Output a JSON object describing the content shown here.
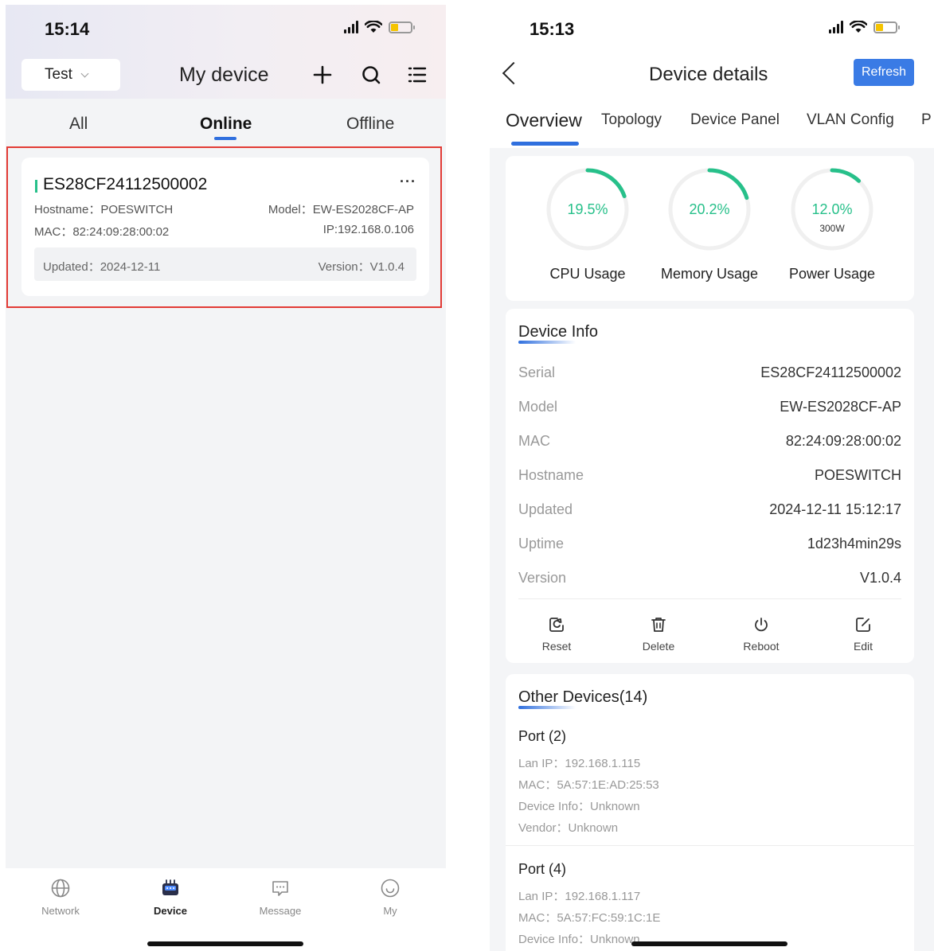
{
  "left": {
    "status": {
      "time": "15:14"
    },
    "header": {
      "org_select": "Test",
      "title": "My device"
    },
    "filter_tabs": [
      {
        "label": "All"
      },
      {
        "label": "Online",
        "active": true
      },
      {
        "label": "Offline"
      }
    ],
    "device_card": {
      "serial": "ES28CF24112500002",
      "more": "···",
      "hostname": "Hostname：POESWITCH",
      "model": "Model：EW-ES2028CF-AP",
      "mac": "MAC：82:24:09:28:00:02",
      "ip": "IP:192.168.0.106",
      "updated": "Updated：2024-12-11",
      "version": "Version：V1.0.4"
    },
    "tabbar": [
      {
        "label": "Network",
        "icon": "globe-icon"
      },
      {
        "label": "Device",
        "icon": "switch-icon",
        "active": true
      },
      {
        "label": "Message",
        "icon": "chat-icon"
      },
      {
        "label": "My",
        "icon": "smile-icon"
      }
    ]
  },
  "right": {
    "status": {
      "time": "15:13"
    },
    "header": {
      "title": "Device details",
      "refresh": "Refresh"
    },
    "tabs": [
      {
        "label": "Overview",
        "active": true
      },
      {
        "label": "Topology"
      },
      {
        "label": "Device Panel"
      },
      {
        "label": "VLAN Config"
      },
      {
        "label": "P"
      }
    ],
    "usage": [
      {
        "label": "CPU Usage",
        "value": "19.5%",
        "percent": 19.5,
        "sub": ""
      },
      {
        "label": "Memory Usage",
        "value": "20.2%",
        "percent": 20.2,
        "sub": ""
      },
      {
        "label": "Power Usage",
        "value": "12.0%",
        "percent": 12.0,
        "sub": "300W"
      }
    ],
    "device_info": {
      "title": "Device Info",
      "rows": [
        {
          "key": "Serial",
          "value": "ES28CF24112500002"
        },
        {
          "key": "Model",
          "value": "EW-ES2028CF-AP"
        },
        {
          "key": "MAC",
          "value": "82:24:09:28:00:02"
        },
        {
          "key": "Hostname",
          "value": "POESWITCH"
        },
        {
          "key": "Updated",
          "value": "2024-12-11 15:12:17"
        },
        {
          "key": "Uptime",
          "value": "1d23h4min29s"
        },
        {
          "key": "Version",
          "value": "V1.0.4"
        }
      ],
      "actions": [
        {
          "label": "Reset",
          "icon": "reset-icon"
        },
        {
          "label": "Delete",
          "icon": "trash-icon"
        },
        {
          "label": "Reboot",
          "icon": "power-icon"
        },
        {
          "label": "Edit",
          "icon": "edit-icon"
        }
      ]
    },
    "other_devices": {
      "title": "Other Devices(14)",
      "ports": [
        {
          "title": "Port (2)",
          "lan_ip": "Lan IP：192.168.1.115",
          "mac": "MAC：5A:57:1E:AD:25:53",
          "device_info": "Device Info：Unknown",
          "vendor": "Vendor：Unknown"
        },
        {
          "title": "Port (4)",
          "lan_ip": "Lan IP：192.168.1.117",
          "mac": "MAC：5A:57:FC:59:1C:1E",
          "device_info": "Device Info：Unknown"
        }
      ]
    },
    "colors": {
      "accent": "#3a7be5",
      "gauge": "#27c08a",
      "highlight": "#e23b35"
    }
  }
}
